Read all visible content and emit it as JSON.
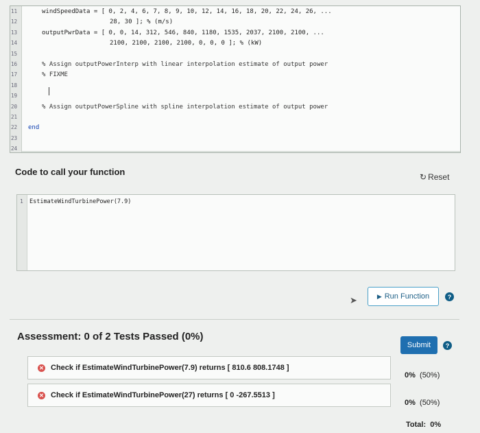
{
  "editor": {
    "line_numbers": [
      "11",
      "12",
      "13",
      "14",
      "15",
      "16",
      "17",
      "18",
      "19",
      "20",
      "21",
      "22",
      "23",
      "24"
    ],
    "lines": {
      "l11": "windSpeedData = [ 0, 2, 4, 6, 7, 8, 9, 10, 12, 14, 16, 18, 20, 22, 24, 26, ...",
      "l12": "28, 30 ]; % (m/s)",
      "l13": "outputPwrData = [ 0, 0, 14, 312, 546, 840, 1180, 1535, 2037, 2100, 2100, ...",
      "l14": "2100, 2100, 2100, 2100, 0, 0, 0 ]; % (kW)",
      "l16": "% Assign outputPowerInterp with linear interpolation estimate of output power",
      "l17": "% FIXME",
      "l20": "% Assign outputPowerSpline with spline interpolation estimate of output power",
      "l22": "end"
    }
  },
  "call_section": {
    "title": "Code to call your function",
    "reset_label": "Reset",
    "line_number": "1",
    "code": "EstimateWindTurbinePower(7.9)"
  },
  "run_button_label": "Run Function",
  "help_mark": "?",
  "assessment": {
    "title": "Assessment: 0 of 2 Tests Passed (0%)",
    "submit_label": "Submit",
    "tests": [
      {
        "label": "Check if EstimateWindTurbinePower(7.9) returns [ 810.6 808.1748 ]",
        "score": "0%",
        "weight": "(50%)"
      },
      {
        "label": "Check if EstimateWindTurbinePower(27) returns [ 0 -267.5513 ]",
        "score": "0%",
        "weight": "(50%)"
      }
    ],
    "total_label": "Total:",
    "total_value": "0%"
  },
  "colors": {
    "accent": "#1f6fb0",
    "fail": "#d9534f",
    "help": "#0f5d86"
  }
}
